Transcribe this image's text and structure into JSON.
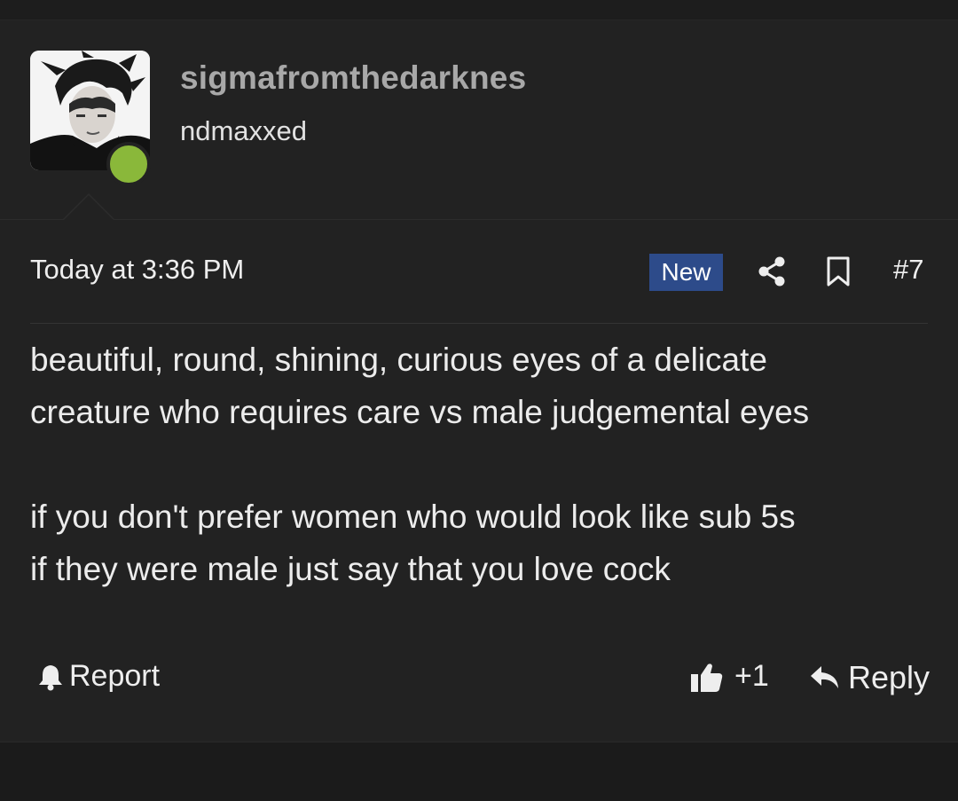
{
  "post": {
    "author": {
      "username": "sigmafromthedarknes",
      "user_title": "ndmaxxed",
      "avatar_icon": "user-avatar-photo",
      "online_status_color": "#8ab83a"
    },
    "meta": {
      "timestamp": "Today at 3:36 PM",
      "new_badge": "New",
      "share_icon": "share-icon",
      "bookmark_icon": "bookmark-icon",
      "post_number": "#7"
    },
    "message": {
      "paragraph_1_line_1": "beautiful, round, shining, curious eyes of a delicate",
      "paragraph_1_line_2": "creature who requires care vs male judgemental eyes",
      "paragraph_2_line_1": "if you don't prefer women who would look like sub 5s",
      "paragraph_2_line_2": "if they were male just say that you love cock"
    },
    "actions": {
      "report_label": "Report",
      "like_count": "+1",
      "reply_label": "Reply"
    }
  },
  "colors": {
    "page_background": "#1b1b1b",
    "post_background": "#222222",
    "badge_background": "#2d4b8a",
    "username_color": "#a8a8a8",
    "text_color": "#eeeeee"
  }
}
